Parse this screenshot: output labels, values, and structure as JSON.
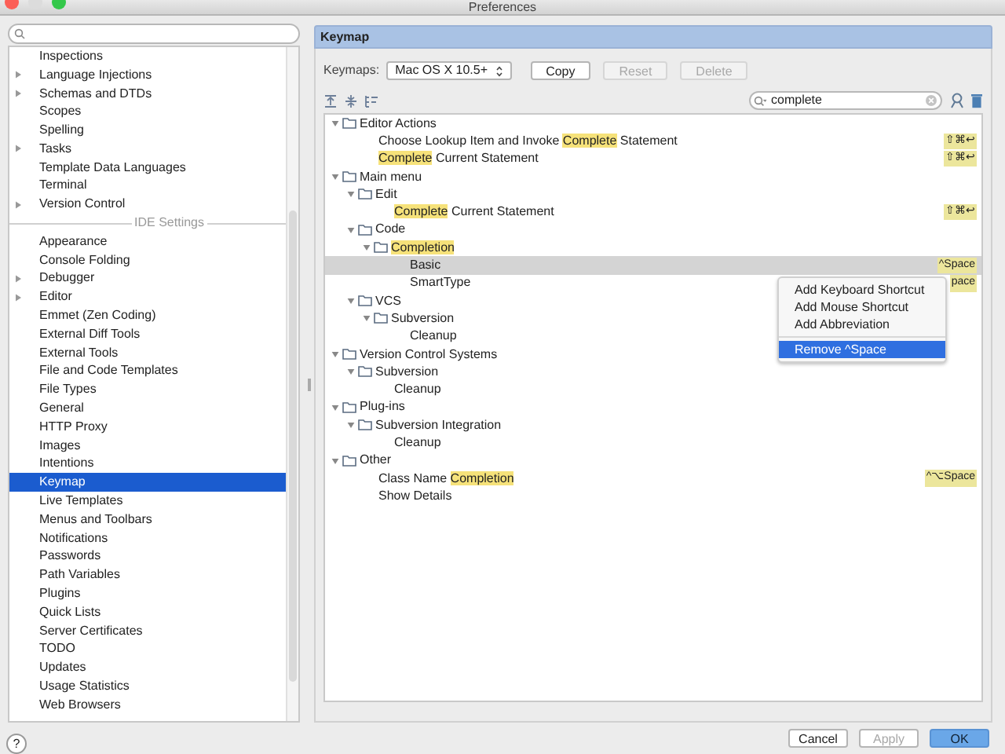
{
  "window": {
    "title": "Preferences"
  },
  "sidebar": {
    "items": [
      {
        "label": "Inspections",
        "kind": "page",
        "selected": false
      },
      {
        "label": "Language Injections",
        "kind": "group",
        "selected": false
      },
      {
        "label": "Schemas and DTDs",
        "kind": "group",
        "selected": false
      },
      {
        "label": "Scopes",
        "kind": "page",
        "selected": false
      },
      {
        "label": "Spelling",
        "kind": "page",
        "selected": false
      },
      {
        "label": "Tasks",
        "kind": "group",
        "selected": false
      },
      {
        "label": "Template Data Languages",
        "kind": "page",
        "selected": false
      },
      {
        "label": "Terminal",
        "kind": "page",
        "selected": false
      },
      {
        "label": "Version Control",
        "kind": "group",
        "selected": false
      },
      {
        "label": "IDE Settings",
        "kind": "separator",
        "selected": false
      },
      {
        "label": "Appearance",
        "kind": "page",
        "selected": false
      },
      {
        "label": "Console Folding",
        "kind": "page",
        "selected": false
      },
      {
        "label": "Debugger",
        "kind": "group",
        "selected": false
      },
      {
        "label": "Editor",
        "kind": "group",
        "selected": false
      },
      {
        "label": "Emmet (Zen Coding)",
        "kind": "page",
        "selected": false
      },
      {
        "label": "External Diff Tools",
        "kind": "page",
        "selected": false
      },
      {
        "label": "External Tools",
        "kind": "page",
        "selected": false
      },
      {
        "label": "File and Code Templates",
        "kind": "page",
        "selected": false
      },
      {
        "label": "File Types",
        "kind": "page",
        "selected": false
      },
      {
        "label": "General",
        "kind": "page",
        "selected": false
      },
      {
        "label": "HTTP Proxy",
        "kind": "page",
        "selected": false
      },
      {
        "label": "Images",
        "kind": "page",
        "selected": false
      },
      {
        "label": "Intentions",
        "kind": "page",
        "selected": false
      },
      {
        "label": "Keymap",
        "kind": "page",
        "selected": true
      },
      {
        "label": "Live Templates",
        "kind": "page",
        "selected": false
      },
      {
        "label": "Menus and Toolbars",
        "kind": "page",
        "selected": false
      },
      {
        "label": "Notifications",
        "kind": "page",
        "selected": false
      },
      {
        "label": "Passwords",
        "kind": "page",
        "selected": false
      },
      {
        "label": "Path Variables",
        "kind": "page",
        "selected": false
      },
      {
        "label": "Plugins",
        "kind": "page",
        "selected": false
      },
      {
        "label": "Quick Lists",
        "kind": "page",
        "selected": false
      },
      {
        "label": "Server Certificates",
        "kind": "page",
        "selected": false
      },
      {
        "label": "TODO",
        "kind": "page",
        "selected": false
      },
      {
        "label": "Updates",
        "kind": "page",
        "selected": false
      },
      {
        "label": "Usage Statistics",
        "kind": "page",
        "selected": false
      },
      {
        "label": "Web Browsers",
        "kind": "page",
        "selected": false
      }
    ]
  },
  "panel": {
    "title": "Keymap",
    "keymaps_label": "Keymaps:",
    "keymap_value": "Mac OS X 10.5+",
    "buttons": [
      {
        "label": "Copy",
        "disabled": false
      },
      {
        "label": "Reset",
        "disabled": true
      },
      {
        "label": "Delete",
        "disabled": true
      }
    ],
    "search": {
      "value": "complete"
    },
    "tree": [
      {
        "kind": "folder",
        "expanded": true,
        "selected": false,
        "parts": [
          {
            "text": "Editor Actions",
            "match": false
          }
        ],
        "children": [
          {
            "kind": "action",
            "selected": false,
            "parts": [
              {
                "text": "Choose Lookup Item and Invoke ",
                "match": false
              },
              {
                "text": "Complete",
                "match": true
              },
              {
                "text": " Statement",
                "match": false
              }
            ],
            "shortcut": "⇧⌘↩"
          },
          {
            "kind": "action",
            "selected": false,
            "parts": [
              {
                "text": "Complete",
                "match": true
              },
              {
                "text": " Current Statement",
                "match": false
              }
            ],
            "shortcut": "⇧⌘↩"
          }
        ]
      },
      {
        "kind": "folder",
        "expanded": true,
        "selected": false,
        "parts": [
          {
            "text": "Main menu",
            "match": false
          }
        ],
        "children": [
          {
            "kind": "folder",
            "expanded": true,
            "selected": false,
            "parts": [
              {
                "text": "Edit",
                "match": false
              }
            ],
            "children": [
              {
                "kind": "action",
                "selected": false,
                "parts": [
                  {
                    "text": "Complete",
                    "match": true
                  },
                  {
                    "text": " Current Statement",
                    "match": false
                  }
                ],
                "shortcut": "⇧⌘↩"
              }
            ]
          },
          {
            "kind": "folder",
            "expanded": true,
            "selected": false,
            "parts": [
              {
                "text": "Code",
                "match": false
              }
            ],
            "children": [
              {
                "kind": "folder",
                "expanded": true,
                "selected": false,
                "parts": [
                  {
                    "text": "Completion",
                    "match": true
                  }
                ],
                "children": [
                  {
                    "kind": "action",
                    "selected": true,
                    "parts": [
                      {
                        "text": "Basic",
                        "match": false
                      }
                    ],
                    "shortcut": "^Space"
                  },
                  {
                    "kind": "action",
                    "selected": false,
                    "parts": [
                      {
                        "text": "SmartType",
                        "match": false
                      }
                    ],
                    "shortcut": "pace"
                  }
                ]
              }
            ]
          },
          {
            "kind": "folder",
            "expanded": true,
            "selected": false,
            "parts": [
              {
                "text": "VCS",
                "match": false
              }
            ],
            "children": [
              {
                "kind": "folder",
                "expanded": true,
                "selected": false,
                "parts": [
                  {
                    "text": "Subversion",
                    "match": false
                  }
                ],
                "children": [
                  {
                    "kind": "action",
                    "selected": false,
                    "parts": [
                      {
                        "text": "Cleanup",
                        "match": false
                      }
                    ]
                  }
                ]
              }
            ]
          }
        ]
      },
      {
        "kind": "folder",
        "expanded": true,
        "selected": false,
        "parts": [
          {
            "text": "Version Control Systems",
            "match": false
          }
        ],
        "children": [
          {
            "kind": "folder",
            "expanded": true,
            "selected": false,
            "parts": [
              {
                "text": "Subversion",
                "match": false
              }
            ],
            "children": [
              {
                "kind": "action",
                "selected": false,
                "parts": [
                  {
                    "text": "Cleanup",
                    "match": false
                  }
                ]
              }
            ]
          }
        ]
      },
      {
        "kind": "folder",
        "expanded": true,
        "selected": false,
        "parts": [
          {
            "text": "Plug-ins",
            "match": false
          }
        ],
        "children": [
          {
            "kind": "folder",
            "expanded": true,
            "selected": false,
            "parts": [
              {
                "text": "Subversion Integration",
                "match": false
              }
            ],
            "children": [
              {
                "kind": "action",
                "selected": false,
                "parts": [
                  {
                    "text": "Cleanup",
                    "match": false
                  }
                ]
              }
            ]
          }
        ]
      },
      {
        "kind": "folder",
        "expanded": true,
        "selected": false,
        "parts": [
          {
            "text": "Other",
            "match": false
          }
        ],
        "children": [
          {
            "kind": "action",
            "selected": false,
            "parts": [
              {
                "text": "Class Name ",
                "match": false
              },
              {
                "text": "Completion",
                "match": true
              }
            ],
            "shortcut": "^⌥Space"
          },
          {
            "kind": "action",
            "selected": false,
            "parts": [
              {
                "text": "Show Details",
                "match": false
              }
            ]
          }
        ]
      }
    ],
    "context_menu": [
      {
        "kind": "item",
        "label": "Add Keyboard Shortcut",
        "selected": false
      },
      {
        "kind": "item",
        "label": "Add Mouse Shortcut",
        "selected": false
      },
      {
        "kind": "item",
        "label": "Add Abbreviation",
        "selected": false
      },
      {
        "kind": "separator"
      },
      {
        "kind": "item",
        "label": "Remove ^Space",
        "selected": true
      }
    ]
  },
  "footer": {
    "help": "?",
    "buttons": [
      {
        "label": "Cancel",
        "kind": "normal",
        "disabled": false
      },
      {
        "label": "Apply",
        "kind": "normal",
        "disabled": true
      },
      {
        "label": "OK",
        "kind": "default",
        "disabled": false
      }
    ]
  }
}
